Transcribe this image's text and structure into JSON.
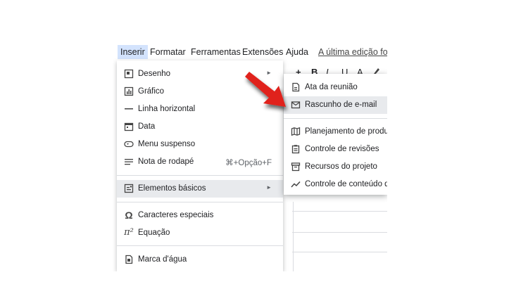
{
  "menubar": {
    "items": [
      "Inserir",
      "Formatar",
      "Ferramentas",
      "Extensões",
      "Ajuda"
    ],
    "last_edit": "A última edição foi h"
  },
  "toolbar": {
    "plus": "+",
    "bold": "B",
    "italic": "I",
    "underline": "U",
    "text_color": "A"
  },
  "insert_menu": {
    "items": [
      {
        "label": "Desenho",
        "icon": "drawing-icon",
        "has_submenu": true
      },
      {
        "label": "Gráfico",
        "icon": "chart-icon"
      },
      {
        "label": "Linha horizontal",
        "icon": "horizontal-line-icon"
      },
      {
        "label": "Data",
        "icon": "calendar-icon"
      },
      {
        "label": "Menu suspenso",
        "icon": "dropdown-chip-icon"
      },
      {
        "label": "Nota de rodapé",
        "icon": "footnote-icon",
        "shortcut": "⌘+Opção+F"
      },
      {
        "label": "Elementos básicos",
        "icon": "building-blocks-icon",
        "has_submenu": true,
        "highlighted": true
      },
      {
        "label": "Caracteres especiais",
        "icon": "omega-icon"
      },
      {
        "label": "Equação",
        "icon": "pi-icon"
      },
      {
        "label": "Marca d'água",
        "icon": "watermark-icon"
      }
    ]
  },
  "submenu": {
    "items": [
      {
        "label": "Ata da reunião",
        "icon": "document-icon"
      },
      {
        "label": "Rascunho de e-mail",
        "icon": "email-icon",
        "highlighted": true
      },
      {
        "label": "Planejamento de produ",
        "icon": "map-icon"
      },
      {
        "label": "Controle de revisões",
        "icon": "clipboard-icon"
      },
      {
        "label": "Recursos do projeto",
        "icon": "archive-icon"
      },
      {
        "label": "Controle de conteúdo d",
        "icon": "trend-icon"
      }
    ]
  },
  "colors": {
    "highlight": "#e8eaed",
    "active_menu": "#d3e3fd",
    "arrow": "#e0201a"
  }
}
